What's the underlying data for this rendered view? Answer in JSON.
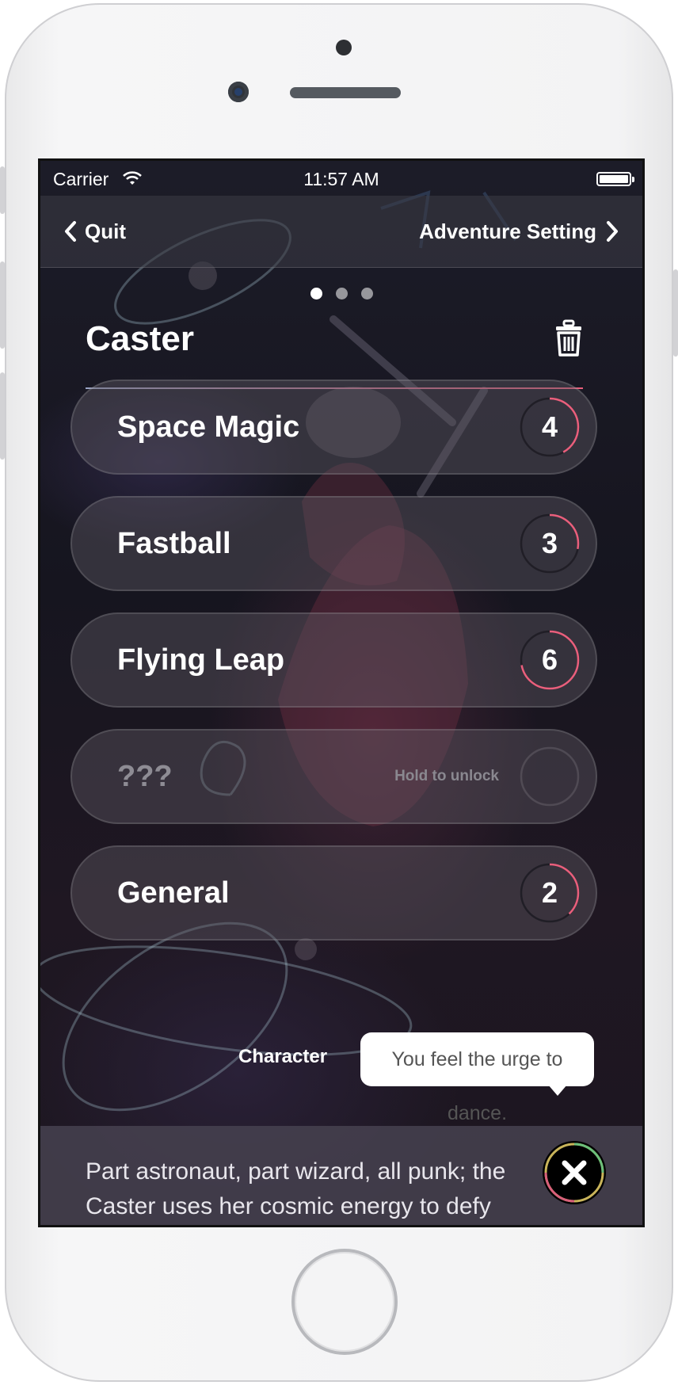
{
  "status_bar": {
    "carrier": "Carrier",
    "time": "11:57 AM"
  },
  "nav": {
    "back_label": "Quit",
    "forward_label": "Adventure Setting"
  },
  "pager": {
    "page_count": 3,
    "current_page": 1
  },
  "character": {
    "class_name": "Caster"
  },
  "skills": [
    {
      "name": "Space Magic",
      "value": "4",
      "progress": 0.42,
      "locked": false
    },
    {
      "name": "Fastball",
      "value": "3",
      "progress": 0.28,
      "locked": false
    },
    {
      "name": "Flying Leap",
      "value": "6",
      "progress": 0.72,
      "locked": false
    },
    {
      "name": "???",
      "value": "",
      "hint": "Hold to unlock",
      "progress": 0,
      "locked": true
    },
    {
      "name": "General",
      "value": "2",
      "progress": 0.38,
      "locked": false
    }
  ],
  "footer": {
    "character_label": "Character",
    "tooltip": "You feel the urge to dance.",
    "description": "Part astronaut, part wizard, all punk; the Caster uses her cosmic energy to defy the"
  },
  "colors": {
    "accent": "#ea5f7c",
    "background": "#18161f"
  }
}
